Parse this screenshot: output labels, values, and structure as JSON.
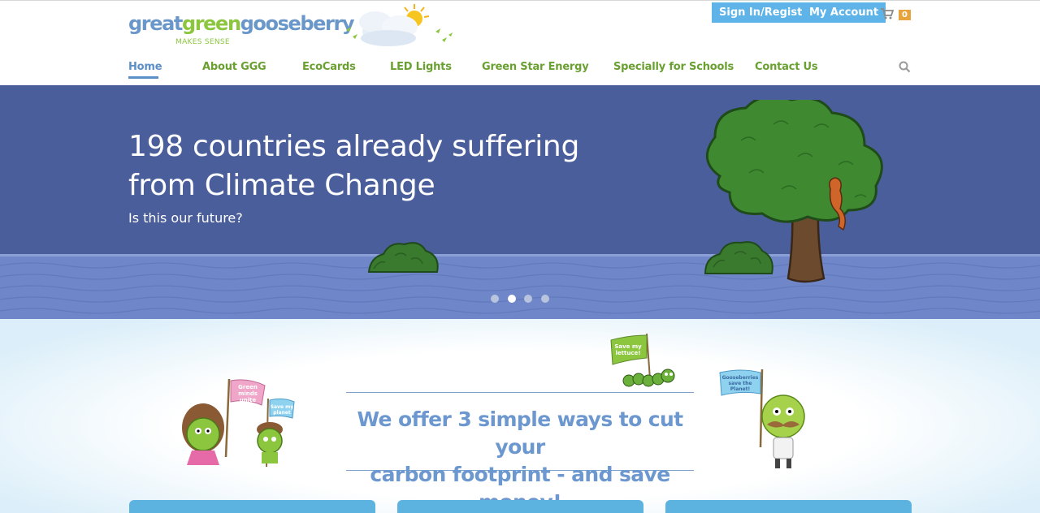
{
  "logo": {
    "part_great": "great",
    "part_green": "green",
    "part_gooseberry": "gooseberry",
    "tagline": "MAKES SENSE"
  },
  "account": {
    "signin_label": "Sign In/Register",
    "account_label": "My Account",
    "cart_count": "0"
  },
  "nav": {
    "items": [
      "Home",
      "About GGG",
      "EcoCards",
      "LED Lights",
      "Green Star Energy",
      "Specially for Schools",
      "Contact Us"
    ],
    "active_index": 0
  },
  "hero": {
    "title_line1": "198 countries already suffering",
    "title_line2": "from Climate Change",
    "subtitle": "Is this our future?",
    "slides": 4,
    "active_slide": 1
  },
  "promo": {
    "tagline_line1": "We offer 3 simple ways to cut your",
    "tagline_line2": "carbon footprint - and save money!",
    "flag_left_1": "Green",
    "flag_left_2": "minds",
    "flag_left_3": "unite",
    "flag_small_1": "Save my",
    "flag_small_2": "planet",
    "flag_lettuce_1": "Save my",
    "flag_lettuce_2": "lettuce!",
    "flag_right_1": "Gooseberries",
    "flag_right_2": "save the",
    "flag_right_3": "Planet!"
  },
  "colors": {
    "nav_green": "#6aa032",
    "nav_active_blue": "#5b8fc7",
    "button_blue": "#5eb4e8",
    "hero_sky": "#4b5e9c",
    "water": "#6f86c8",
    "cart_badge": "#e8a33c",
    "tagline_blue": "#6c98cf"
  }
}
